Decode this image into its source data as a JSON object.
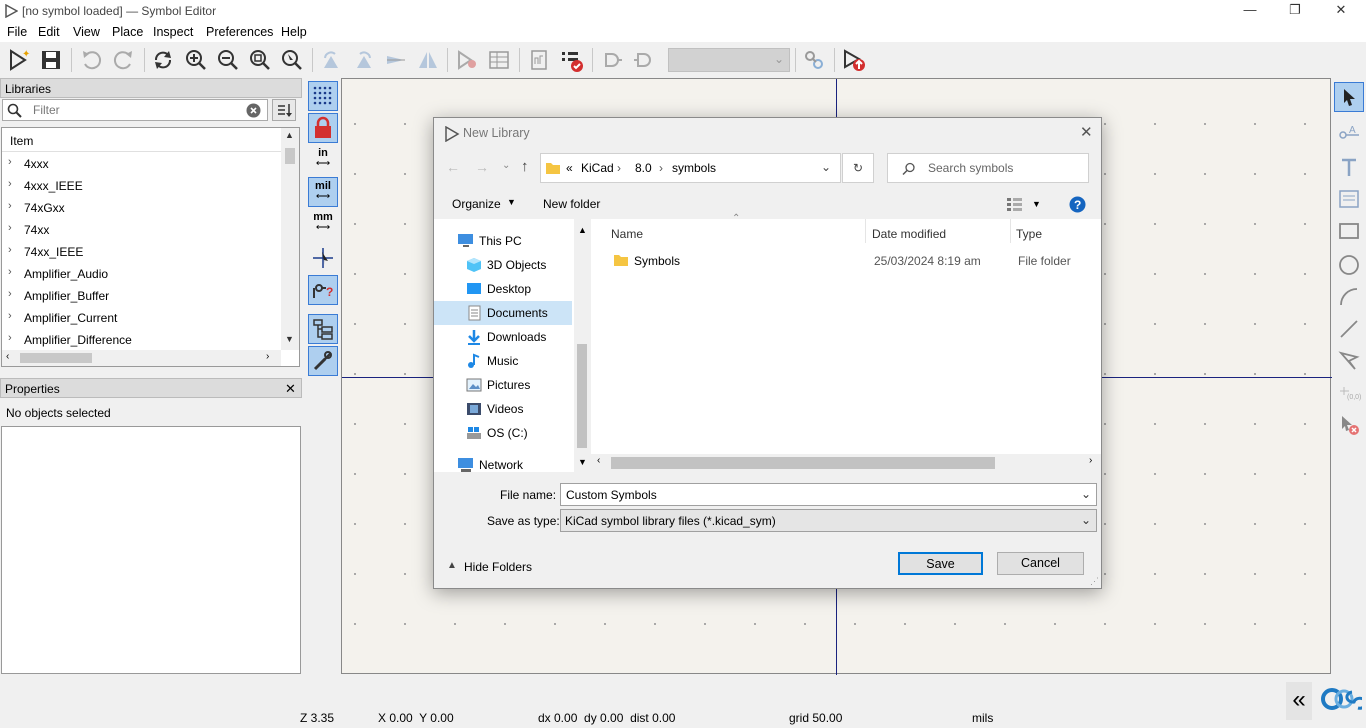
{
  "window": {
    "title": "[no symbol loaded] — Symbol Editor"
  },
  "menu": [
    "File",
    "Edit",
    "View",
    "Place",
    "Inspect",
    "Preferences",
    "Help"
  ],
  "left_panel": {
    "libraries_header": "Libraries",
    "filter_placeholder": "Filter",
    "column_header": "Item",
    "items": [
      "4xxx",
      "4xxx_IEEE",
      "74xGxx",
      "74xx",
      "74xx_IEEE",
      "Amplifier_Audio",
      "Amplifier_Buffer",
      "Amplifier_Current",
      "Amplifier_Difference"
    ],
    "properties_header": "Properties",
    "properties_text": "No objects selected"
  },
  "units": {
    "in": "in",
    "mil": "mil",
    "mm": "mm"
  },
  "statusbar": {
    "zoom": "Z 3.35",
    "coords": "X 0.00  Y 0.00",
    "delta": "dx 0.00  dy 0.00  dist 0.00",
    "grid": "grid 50.00",
    "units": "mils"
  },
  "dialog": {
    "title": "New Library",
    "breadcrumb": [
      "«",
      "KiCad",
      "8.0",
      "symbols"
    ],
    "search_placeholder": "Search symbols",
    "organize": "Organize",
    "new_folder": "New folder",
    "nav_items": [
      "This PC",
      "3D Objects",
      "Desktop",
      "Documents",
      "Downloads",
      "Music",
      "Pictures",
      "Videos",
      "OS (C:)",
      "Network"
    ],
    "columns": {
      "name": "Name",
      "date": "Date modified",
      "type": "Type"
    },
    "files": [
      {
        "name": "Symbols",
        "date": "25/03/2024 8:19 am",
        "type": "File folder"
      }
    ],
    "file_name_label": "File name:",
    "file_name_value": "Custom Symbols",
    "save_type_label": "Save as type:",
    "save_type_value": "KiCad symbol library files (*.kicad_sym)",
    "hide_folders": "Hide Folders",
    "save": "Save",
    "cancel": "Cancel"
  },
  "colors": {
    "accent": "#3a7bd5",
    "crosshair": "#1a237e",
    "toggle_bg": "#aecfef",
    "help": "#1565c0"
  }
}
